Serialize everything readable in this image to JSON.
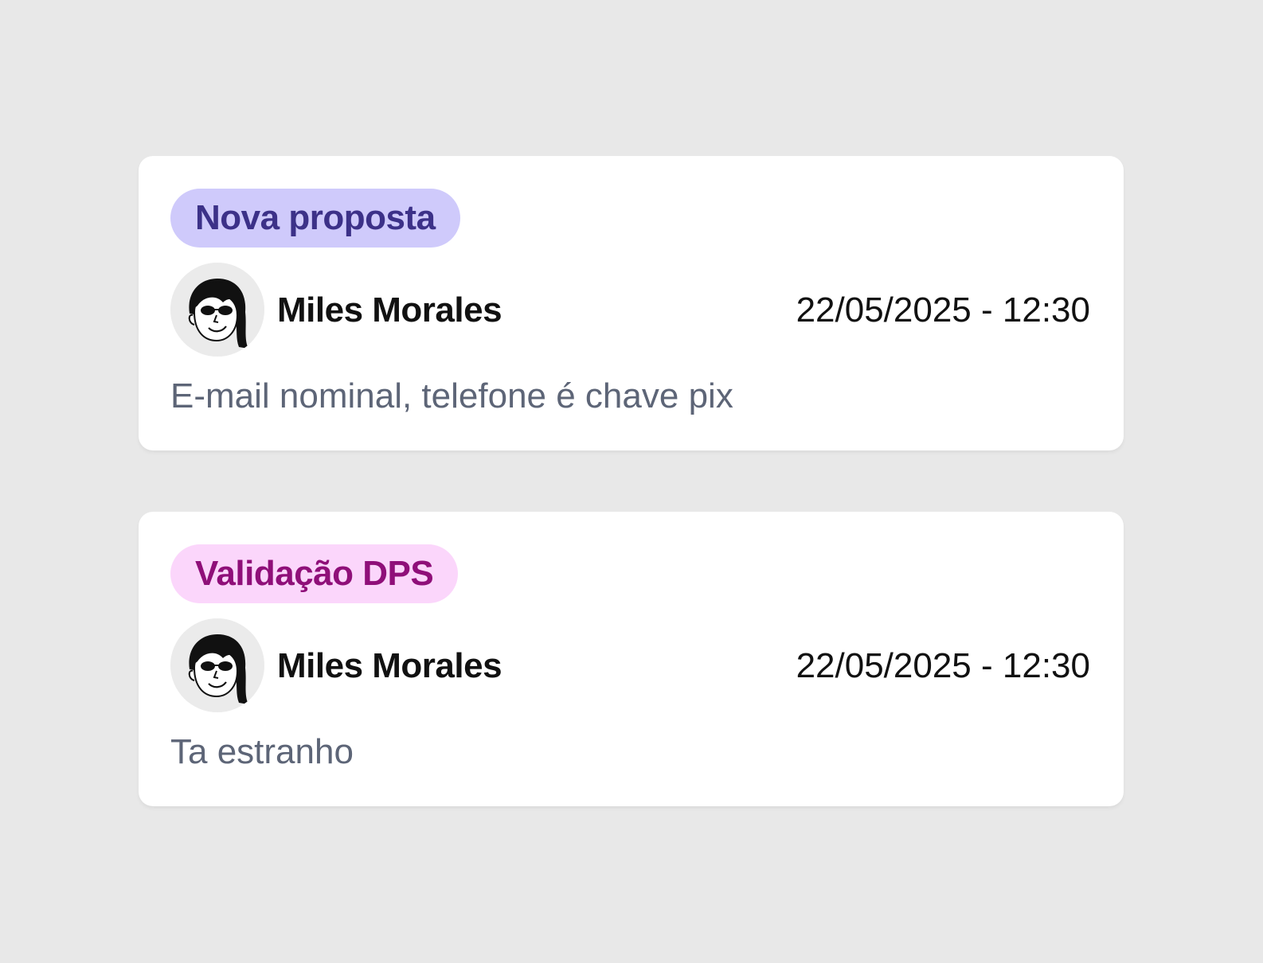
{
  "comments": [
    {
      "tag": {
        "label": "Nova proposta",
        "bg": "#cfcafb",
        "fg": "#3c3188"
      },
      "author": "Miles Morales",
      "timestamp": "22/05/2025 - 12:30",
      "text": "E-mail nominal, telefone é chave pix",
      "avatar_icon": "user-avatar-icon"
    },
    {
      "tag": {
        "label": "Validação DPS",
        "bg": "#fbd6fb",
        "fg": "#8f0f79"
      },
      "author": "Miles Morales",
      "timestamp": "22/05/2025 - 12:30",
      "text": "Ta estranho",
      "avatar_icon": "user-avatar-icon"
    }
  ],
  "colors": {
    "page_background": "#e8e8e8",
    "card_background": "#ffffff",
    "author_text": "#111111",
    "comment_text": "#5d6577"
  }
}
